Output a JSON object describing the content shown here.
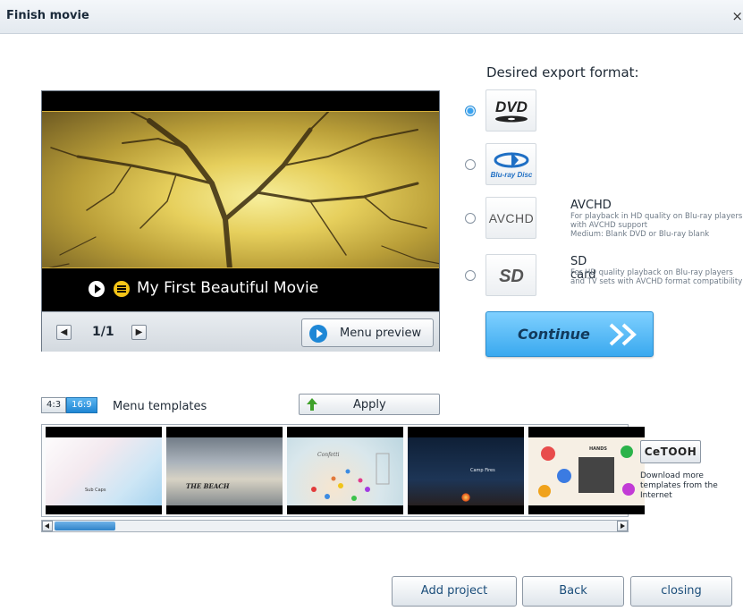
{
  "window": {
    "title": "Finish movie",
    "close_glyph": "×"
  },
  "preview": {
    "movie_title": "My First Beautiful Movie",
    "page_indicator": "1/1",
    "menu_preview_label": "Menu preview",
    "prev_icon": "arrow-left-icon",
    "next_icon": "arrow-right-icon"
  },
  "export": {
    "title": "Desired export format:",
    "formats": [
      {
        "id": "dvd",
        "logo_text": "DVD",
        "name": "",
        "description": "",
        "selected": true
      },
      {
        "id": "bluray",
        "logo_text": "Blu-ray Disc",
        "name": "",
        "description": "",
        "selected": false
      },
      {
        "id": "avchd",
        "logo_text": "AVCHD",
        "name": "AVCHD",
        "description": "For playback in HD quality on Blu-ray players with AVCHD support\nMedium: Blank DVD or Blu-ray blank",
        "selected": false
      },
      {
        "id": "sdcard",
        "logo_text": "SD",
        "name": "SD card",
        "description": "For HD quality playback on Blu-ray players and TV sets with AVCHD format compatibility",
        "selected": false
      }
    ],
    "continue_label": "Continue"
  },
  "templates": {
    "ratio_options": [
      "4:3",
      "16:9"
    ],
    "ratio_selected": "16:9",
    "label": "Menu templates",
    "apply_label": "Apply",
    "thumbnails": [
      {
        "text": "Sub Caps"
      },
      {
        "text": "THE BEACH"
      },
      {
        "text": "Confetti"
      },
      {
        "text": "Camp Fires"
      },
      {
        "text": "HANDS"
      }
    ],
    "scroll_position": 0.0,
    "cetooh_label": "CeTOOH",
    "download_text": "Download more templates from the Internet"
  },
  "footer": {
    "add_project_label": "Add project",
    "back_label": "Back",
    "closing_label": "closing"
  },
  "colors": {
    "accent": "#3aa9ef",
    "selected_radio": "#1f8ad8",
    "title_bar": "#e3e9ef"
  }
}
